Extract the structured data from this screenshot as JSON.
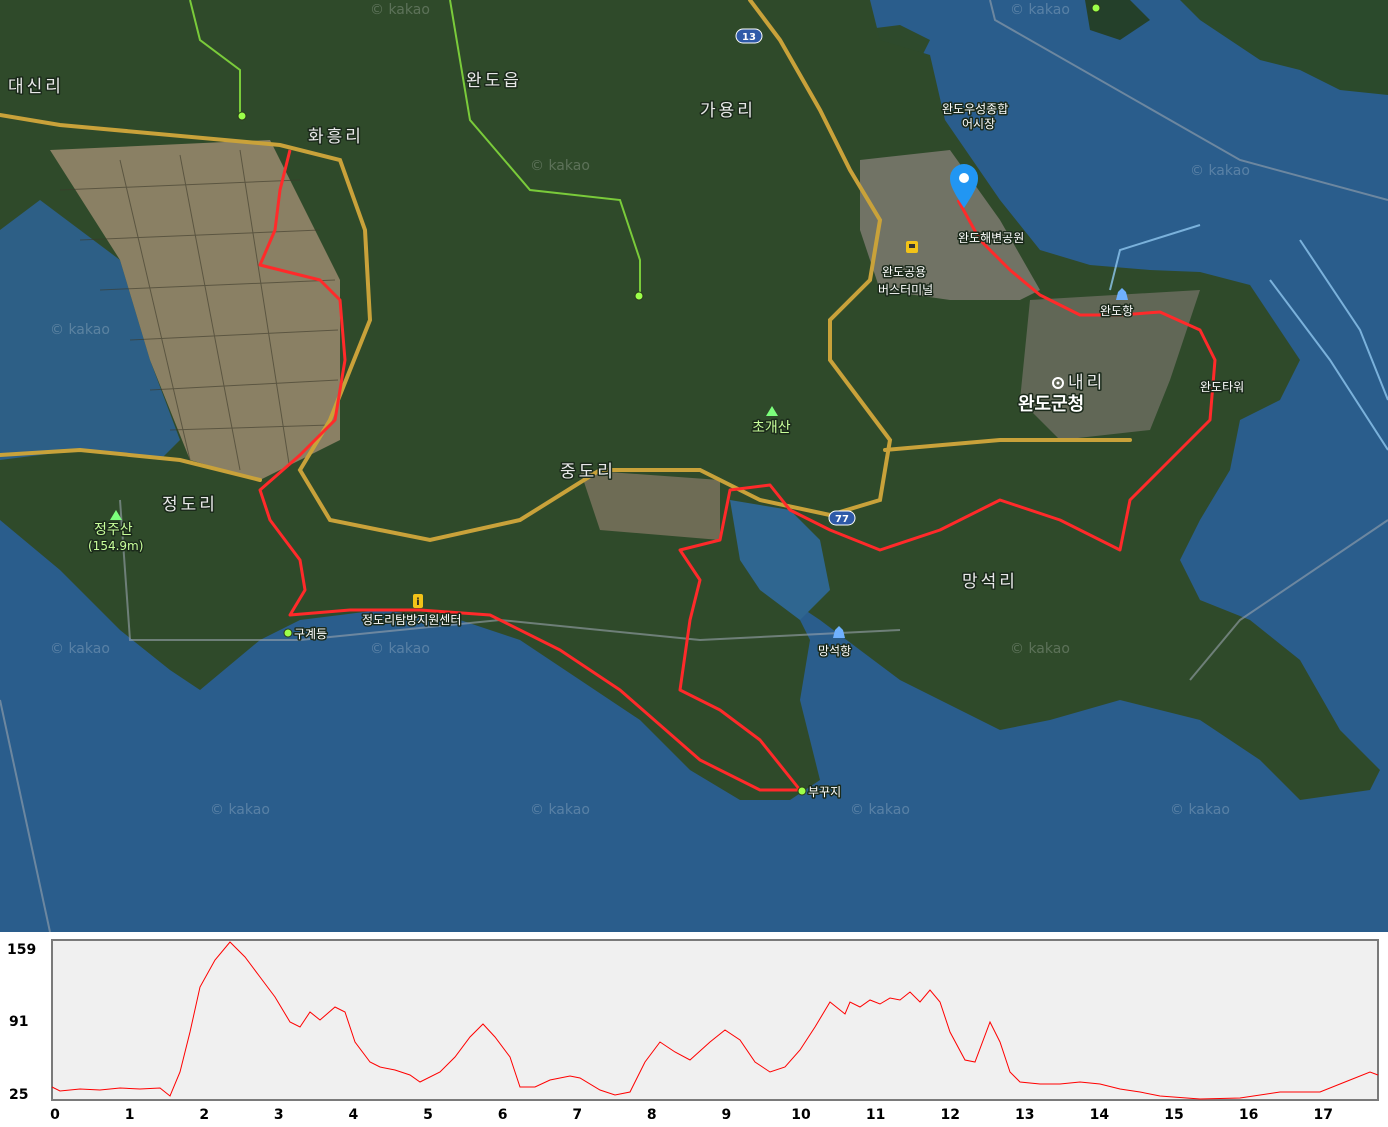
{
  "map": {
    "labels": {
      "daesin_ri": "대신리",
      "wando_eup": "완도읍",
      "hwaheung_ri": "화흥리",
      "gayong_ri": "가용리",
      "fish_market_line1": "완도우성종합",
      "fish_market_line2": "어시장",
      "beach_park": "완도해변공원",
      "bus_terminal_line1": "완도공용",
      "bus_terminal_line2": "버스터미널",
      "wando_port": "완도항",
      "county_office": "완도군청",
      "nae_ri": "내리",
      "wando_tower": "완도타워",
      "chogaesan": "초개산",
      "jungdo_ri": "중도리",
      "jeongdo_ri": "정도리",
      "jeongjusan": "정주산",
      "jeongjusan_height": "(154.9m)",
      "gugyedeung": "구계등",
      "visitor_center": "정도리탐방지원센터",
      "manseok_ri": "망석리",
      "manseok_port": "망석항",
      "bukkuji": "부꾸지"
    },
    "roads": {
      "route_13": "13",
      "route_77": "77"
    },
    "watermark": "© kakao",
    "colors": {
      "sea": "#2a5d8c",
      "track": "#ff2a2a",
      "road": "#c9a23a",
      "marker": "#2196f3"
    }
  },
  "elevation_profile": {
    "y_ticks": [
      "159",
      "91",
      "25"
    ],
    "x_ticks": [
      "0",
      "1",
      "2",
      "3",
      "4",
      "5",
      "6",
      "7",
      "8",
      "9",
      "10",
      "11",
      "12",
      "13",
      "14",
      "15",
      "16",
      "17"
    ],
    "colors": {
      "line": "#ff0000",
      "background": "#f0f0f0"
    }
  }
}
